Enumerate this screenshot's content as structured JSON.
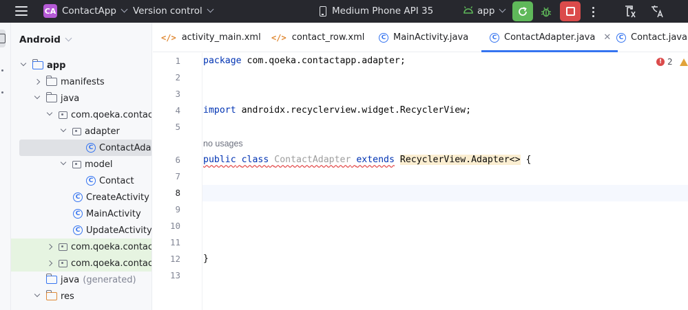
{
  "titlebar": {
    "project_badge": "CA",
    "project_name": "ContactApp",
    "vcs_label": "Version control",
    "device_label": "Medium Phone API 35",
    "run_config": "app"
  },
  "panel": {
    "view_label": "Android",
    "tree": [
      {
        "label": "app",
        "bold": true
      },
      {
        "label": "manifests"
      },
      {
        "label": "java"
      },
      {
        "label": "com.qoeka.contactapp"
      },
      {
        "label": "adapter"
      },
      {
        "label": "ContactAdapter"
      },
      {
        "label": "model"
      },
      {
        "label": "Contact"
      },
      {
        "label": "CreateActivity"
      },
      {
        "label": "MainActivity"
      },
      {
        "label": "UpdateActivity"
      },
      {
        "label": "com.qoeka.contactapp"
      },
      {
        "label": "com.qoeka.contactapp"
      },
      {
        "label": "java",
        "suffix": "(generated)"
      },
      {
        "label": "res"
      }
    ]
  },
  "tabs": [
    {
      "label": "activity_main.xml",
      "icon": "xml-icon"
    },
    {
      "label": "contact_row.xml",
      "icon": "xml-icon"
    },
    {
      "label": "MainActivity.java",
      "icon": "class-icon"
    },
    {
      "label": "ContactAdapter.java",
      "icon": "class-icon",
      "active": true
    },
    {
      "label": "Contact.java",
      "icon": "class-icon"
    }
  ],
  "editor": {
    "line_numbers": [
      "1",
      "2",
      "3",
      "4",
      "5",
      "6",
      "7",
      "8",
      "9",
      "10",
      "11",
      "12",
      "13"
    ],
    "current_line": "8",
    "code": {
      "line1_kw": "package",
      "line1_rest": " com.qoeka.contactapp.adapter;",
      "line4_kw": "import",
      "line4_rest": " androidx.recyclerview.widget.RecyclerView;",
      "usage_hint": "no usages",
      "line6_public": "public",
      "line6_class": "class",
      "line6_name": "ContactAdapter",
      "line6_extends": "extends",
      "line6_super": "RecyclerView.Adapter<>",
      "line6_brace": " {",
      "line12": "}"
    },
    "problems": {
      "errors": "2"
    }
  },
  "colors": {
    "titlebar_bg": "#27282e",
    "accent": "#3574f0",
    "keyword": "#0033b3",
    "sync_green": "#5fb85a",
    "stop_red": "#db4b4b"
  }
}
